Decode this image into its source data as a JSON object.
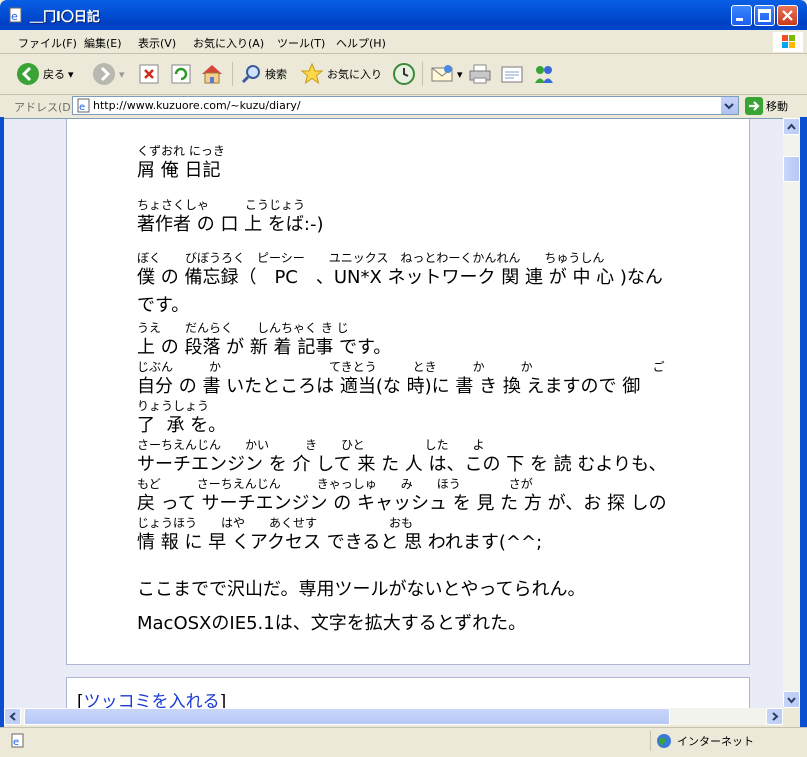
{
  "window": {
    "title": "＿冂I〇日記"
  },
  "menu": {
    "items": [
      "ファイル(F)",
      "編集(E)",
      "表示(V)",
      "お気に入り(A)",
      "ツール(T)",
      "ヘルプ(H)"
    ]
  },
  "toolbar": {
    "back_label": "戻る",
    "search_label": "検索",
    "favorites_label": "お気に入り"
  },
  "address": {
    "label": "アドレス(D)",
    "url": "http://www.kuzuore.com/~kuzu/diary/",
    "go_label": "移動"
  },
  "content": {
    "lines": [
      {
        "ruby": "くずおれ にっき",
        "text": "屑 俺 日記"
      },
      {
        "ruby": "ちょさくしゃ　　　こうじょう",
        "text": "著作者 の 口 上 をば:-)"
      },
      {
        "ruby": "ぼく　　びぼうろく　ピーシー　　ユニックス　ねっとわーくかんれん　　ちゅうしん",
        "text": "僕 の 備忘録（　PC　、UN*X ネットワーク 関 連 が 中 心 )なん"
      },
      {
        "ruby": "",
        "text": "です。"
      },
      {
        "ruby": "うえ　　だんらく　　しんちゃく き じ",
        "text": "上 の 段落 が 新 着 記事 です。"
      },
      {
        "ruby": "じぶん　　　か　　　　　　　　　てきとう　　　とき　　　か　　　か　　　　　　　　　　ご",
        "text": "自分 の 書 いたところは 適当(な 時)に 書 き 換 えますので 御"
      },
      {
        "ruby": "りょうしょう",
        "text": "了  承 を。"
      },
      {
        "ruby": "さーちえんじん　　かい　　　き　　ひと　　　　　した　　よ",
        "text": "サーチエンジン を 介 して 来 た 人 は、この 下 を 読 むよりも、"
      },
      {
        "ruby": "もど　　　さーちえんじん　　　きゃっしゅ　　み　　ほう　　　　さが",
        "text": "戻 って サーチエンジン の キャッシュ を 見 た 方 が、お 探 しの"
      },
      {
        "ruby": "じょうほう　　はや　　あくせす　　　　　　おも",
        "text": "情 報 に 早 くアクセス できると 思 われます(^^;"
      }
    ],
    "note1": "ここまでで沢山だ。専用ツールがないとやってられん。",
    "note2": "MacOSXのIE5.1は、文字を拡大するとずれた。",
    "tsukkomi": "ツッコミを入れる"
  },
  "status": {
    "zone": "インターネット"
  },
  "colors": {
    "titlebar": "#0350d6",
    "link": "#1a3ad6",
    "page_bg": "#e9ecf6"
  }
}
